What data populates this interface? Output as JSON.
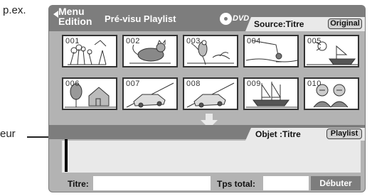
{
  "annotations": {
    "example_label": "p.ex.",
    "cursor_label": "eur"
  },
  "header": {
    "menu_line1": "Menu",
    "menu_line2": "Edition",
    "title": "Pré-visu Playlist",
    "dvd_label": "DVD",
    "source_label": "Source:Titre",
    "original_button": "Original"
  },
  "thumbnails": [
    {
      "number": "001",
      "scene": "flowers"
    },
    {
      "number": "002",
      "scene": "cat"
    },
    {
      "number": "003",
      "scene": "bird"
    },
    {
      "number": "004",
      "scene": "fishing"
    },
    {
      "number": "005",
      "scene": "boat"
    },
    {
      "number": "006",
      "scene": "house"
    },
    {
      "number": "007",
      "scene": "car"
    },
    {
      "number": "008",
      "scene": "car"
    },
    {
      "number": "009",
      "scene": "ship"
    },
    {
      "number": "010",
      "scene": "people"
    }
  ],
  "object_bar": {
    "object_label": "Objet :Titre",
    "playlist_button": "Playlist"
  },
  "footer": {
    "title_label": "Titre:",
    "title_value": "",
    "total_label": "Tps total:",
    "total_value": "",
    "start_button": "Débuter"
  },
  "colors": {
    "header_bg": "#7d7d7d",
    "panel_bg": "#b3b3b3",
    "tab_bg": "#e9e9e9"
  }
}
